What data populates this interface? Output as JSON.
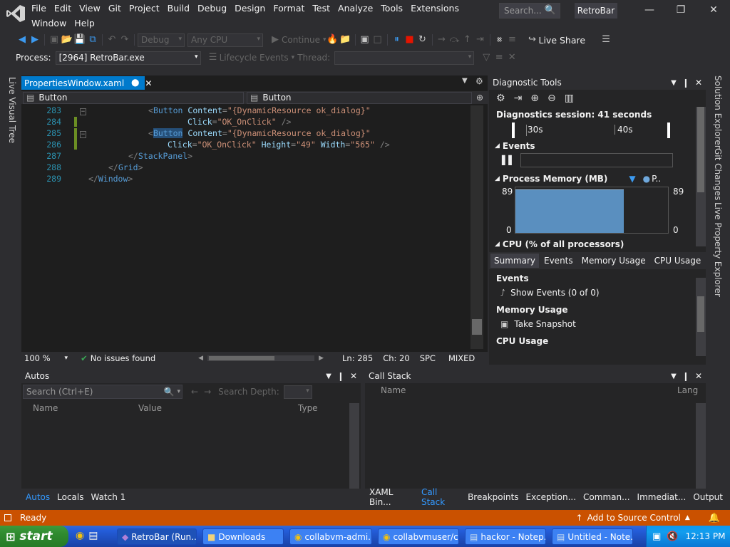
{
  "menu": [
    "File",
    "Edit",
    "View",
    "Git",
    "Project",
    "Build",
    "Debug",
    "Design",
    "Format",
    "Test",
    "Analyze",
    "Tools",
    "Extensions",
    "Window",
    "Help"
  ],
  "search_placeholder": "Search...",
  "app_name": "RetroBar",
  "toolbar": {
    "config": "Debug",
    "platform": "Any CPU",
    "continue_label": "Continue",
    "live_share": "Live Share",
    "process_label": "Process:",
    "process_value": "[2964] RetroBar.exe",
    "lifecycle": "Lifecycle Events",
    "thread_label": "Thread:"
  },
  "left_vtab": "Live Visual Tree",
  "editor": {
    "tab_title": "PropertiesWindow.xaml",
    "nav_left": "Button",
    "nav_right": "Button",
    "lines": [
      {
        "no": "283"
      },
      {
        "no": "284"
      },
      {
        "no": "285"
      },
      {
        "no": "286"
      },
      {
        "no": "287"
      },
      {
        "no": "288"
      },
      {
        "no": "289"
      }
    ],
    "code": {
      "l283_el": "Button",
      "l283_at": "Content",
      "l283_val": "\"{DynamicResource ok_dialog}\"",
      "l284_at": "Click",
      "l284_val": "\"OK_OnClick\"",
      "l285_el": "Button",
      "l285_at": "Content",
      "l285_val": "\"{DynamicResource ok_dialog}\"",
      "l286_at1": "Click",
      "l286_val1": "\"OK_OnClick\"",
      "l286_at2": "Height",
      "l286_val2": "\"49\"",
      "l286_at3": "Width",
      "l286_val3": "\"565\"",
      "l287_el": "StackPanel",
      "l288_el": "Grid",
      "l289_el": "Window"
    },
    "status": {
      "zoom": "100 %",
      "issues": "No issues found",
      "ln": "Ln: 285",
      "ch": "Ch: 20",
      "spc": "SPC",
      "eol": "MIXED"
    }
  },
  "diag": {
    "title": "Diagnostic Tools",
    "session": "Diagnostics session: 41 seconds",
    "t30": "30s",
    "t40": "40s",
    "events_h": "Events",
    "memory_h": "Process Memory (MB)",
    "legend_p": "P..",
    "mem_max": "89",
    "mem_min": "0",
    "cpu_h": "CPU (% of all processors)",
    "tabs": [
      "Summary",
      "Events",
      "Memory Usage",
      "CPU Usage"
    ],
    "sum_events": "Events",
    "show_events": "Show Events (0 of 0)",
    "mem_usage": "Memory Usage",
    "take_snapshot": "Take Snapshot",
    "cpu_usage": "CPU Usage",
    "memory_level": 0.95
  },
  "right_vtabs": [
    "Solution Explorer",
    "Git Changes",
    "Live Property Explorer"
  ],
  "autos": {
    "title": "Autos",
    "search_placeholder": "Search (Ctrl+E)",
    "depth_label": "Search Depth:",
    "col_name": "Name",
    "col_value": "Value",
    "col_type": "Type"
  },
  "callstack": {
    "title": "Call Stack",
    "col_name": "Name",
    "col_lang": "Lang"
  },
  "bottom_tabs_left": [
    "Autos",
    "Locals",
    "Watch 1"
  ],
  "bottom_tabs_right": [
    "XAML Bin...",
    "Call Stack",
    "Breakpoints",
    "Exception...",
    "Comman...",
    "Immediat...",
    "Output"
  ],
  "status": {
    "ready": "Ready",
    "source_control": "Add to Source Control"
  },
  "taskbar": {
    "start": "start",
    "items": [
      "RetroBar (Run...",
      "Downloads",
      "collabvm-admi...",
      "collabvmuser/c...",
      "hackor - Notep...",
      "Untitled - Note..."
    ],
    "clock": "12:13 PM"
  },
  "colors": {
    "accent": "#007acc",
    "status": "#ca5100",
    "taskbar": "#245edb"
  }
}
